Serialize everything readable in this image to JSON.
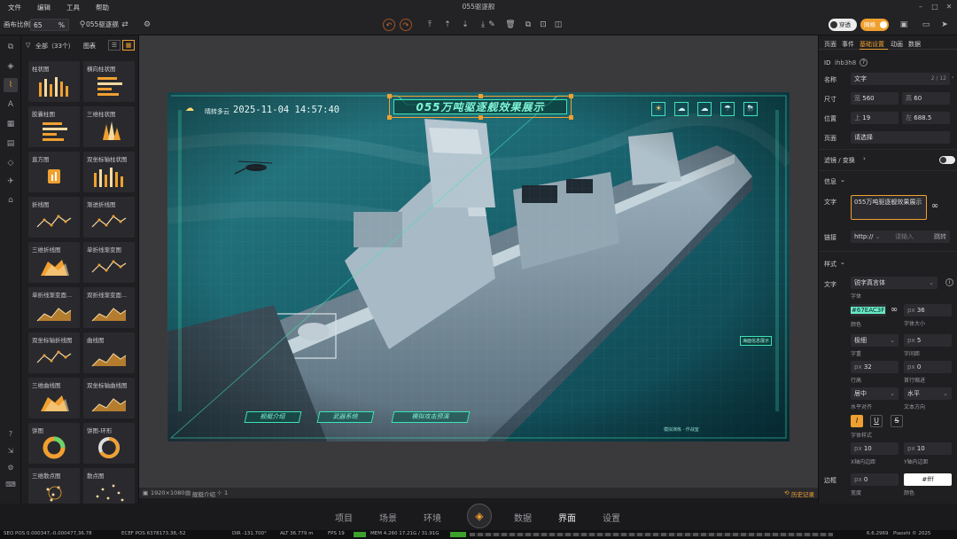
{
  "menu": {
    "items": [
      "文件",
      "编辑",
      "工具",
      "帮助"
    ],
    "window_title": "055驱逐舰"
  },
  "toolbar": {
    "canvas_ratio_label": "画布比例",
    "canvas_ratio_value": "65",
    "percent": "%",
    "project_name": "055驱逐舰",
    "toggle_transparent": "穿透",
    "toggle_grid": "网格"
  },
  "library": {
    "filter_label": "全部（33个）",
    "tab_label": "图表",
    "items": [
      {
        "title": "柱状图",
        "kind": "bars"
      },
      {
        "title": "横向柱状图",
        "kind": "hbars"
      },
      {
        "title": "胶囊柱图",
        "kind": "hbars"
      },
      {
        "title": "三维柱状图",
        "kind": "bars3d"
      },
      {
        "title": "直方图",
        "kind": "single"
      },
      {
        "title": "双坐标轴柱状图",
        "kind": "bars"
      },
      {
        "title": "折线图",
        "kind": "line"
      },
      {
        "title": "渐进折线图",
        "kind": "line"
      },
      {
        "title": "三维折线图",
        "kind": "area3d"
      },
      {
        "title": "单折线渐变图",
        "kind": "line"
      },
      {
        "title": "单折线渐变面...",
        "kind": "area"
      },
      {
        "title": "双折线渐变面...",
        "kind": "area"
      },
      {
        "title": "双坐标轴折线图",
        "kind": "line"
      },
      {
        "title": "曲线图",
        "kind": "area"
      },
      {
        "title": "三维曲线图",
        "kind": "area3d"
      },
      {
        "title": "双坐标轴曲线图",
        "kind": "area"
      },
      {
        "title": "饼图",
        "kind": "pie"
      },
      {
        "title": "饼图-环形",
        "kind": "ring"
      },
      {
        "title": "三维散点图",
        "kind": "scatter3d"
      },
      {
        "title": "散点图",
        "kind": "scatter"
      }
    ]
  },
  "scene": {
    "weather": "晴转多云",
    "datetime": "2025-11-04 14:57:40",
    "title": "055万吨驱逐舰效果展示",
    "buttons": [
      "舰艇介绍",
      "武器系统",
      "模拟攻击预演"
    ],
    "small_label": "海面信息展示",
    "bottom_caption": "模拟演练 · 作战室"
  },
  "status": {
    "resolution": "1920×1080",
    "layer": "舰艇介绍",
    "count": "1",
    "history": "历史记录"
  },
  "right_panel": {
    "tabs": [
      "页面",
      "事件",
      "基础设置",
      "动画",
      "数据"
    ],
    "id_label": "ID",
    "id_value": "ihb3h8",
    "name_label": "名称",
    "name_value": "文字",
    "name_count": "2 / 12",
    "size_label": "尺寸",
    "width_prefix": "宽",
    "width_value": "560",
    "height_prefix": "高",
    "height_value": "60",
    "position_label": "位置",
    "top_prefix": "上",
    "top_value": "19",
    "left_prefix": "左",
    "left_value": "688.5",
    "page_label": "页面",
    "page_value": "请选择",
    "filter_label": "滤镜 / 变换",
    "info_label": "信息",
    "text_label": "文字",
    "text_value": "055万吨驱逐舰效果展示",
    "link_label": "链接",
    "link_protocol": "http://",
    "link_placeholder": "请输入",
    "link_jump": "跳转",
    "style_label": "样式",
    "font_row_label": "文字",
    "font_value": "锐字真言体",
    "font_caption": "字体",
    "color_value": "#67EAC3F",
    "color_caption": "颜色",
    "size_unit": "px",
    "font_size": "36",
    "font_size_caption": "字体大小",
    "weight_value": "极细",
    "weight_caption": "字重",
    "spacing_value": "5",
    "spacing_caption": "字间距",
    "line_height_value": "32",
    "line_height_caption": "行高",
    "indent_value": "0",
    "indent_caption": "首行缩进",
    "align_value": "居中",
    "align_caption": "水平对齐",
    "direction_value": "水平",
    "direction_caption": "文本方向",
    "font_style_caption": "字体样式",
    "pad_x_value": "10",
    "pad_x_caption": "X轴内边距",
    "pad_y_value": "10",
    "pad_y_caption": "Y轴内边距",
    "border_label": "边框",
    "border_width": "0",
    "border_width_caption": "宽度",
    "border_color": "#fff",
    "border_color_caption": "颜色"
  },
  "bottom_nav": [
    "项目",
    "场景",
    "环境",
    "数据",
    "界面",
    "设置"
  ],
  "footer": {
    "seo_pos": "SEO POS 0.000347,-0.000477,36.78",
    "ecef_pos": "ECEF POS 6378173.38,-52",
    "dir": "DIR  -131.700°",
    "alt": "ALT  36.779 m",
    "fps": "FPS  19",
    "mem": "MEM  4.260  17.21G / 31.91G",
    "zoom": "6.6.2969",
    "brand": "Piaoshi © 2025"
  },
  "colors": {
    "accent": "#f0a030",
    "hud": "#3fe3b8",
    "panel": "#1f1f22"
  }
}
